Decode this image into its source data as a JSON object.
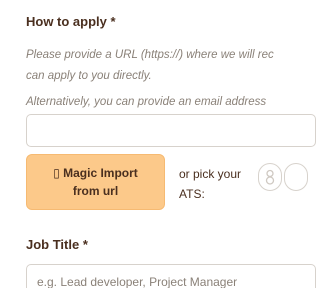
{
  "how_to_apply": {
    "label": "How to apply *",
    "help_line1": "Please provide a URL (https://) where we will rec",
    "help_line2": "can apply to you directly.",
    "help_line3": "Alternatively, you can provide an email address",
    "url_value": ""
  },
  "magic_import": {
    "line1": "▯ Magic Import",
    "line2": "from url"
  },
  "ats": {
    "line1": "or pick your",
    "line2": "ATS:"
  },
  "job_title": {
    "label": "Job Title *",
    "placeholder": "e.g. Lead developer, Project Manager",
    "value": ""
  },
  "colors": {
    "accent_button": "#fcc98a",
    "text_dark": "#4a2f1f",
    "help_text": "#8a8178",
    "border": "#d7d2cc"
  }
}
